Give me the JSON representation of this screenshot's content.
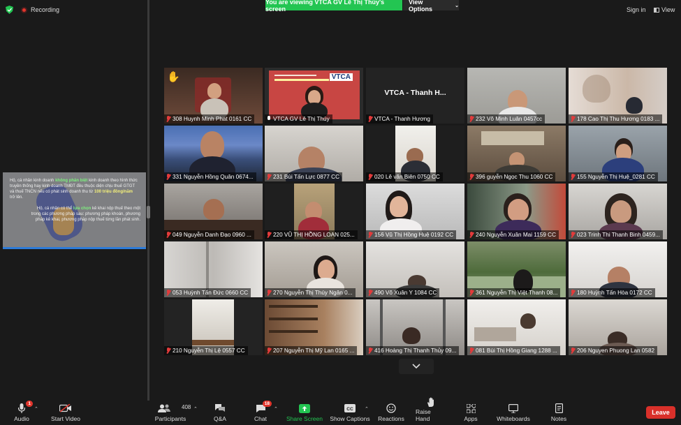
{
  "top": {
    "recording_label": "Recording",
    "viewing_banner": "You are viewing VTCA GV Lê Thị Thúy's screen",
    "view_options": "View Options",
    "sign_in": "Sign in",
    "view": "View"
  },
  "shared_screen": {
    "para1_a": "Hộ, cá nhân kinh doanh ",
    "para1_b": "không phân biệt",
    "para1_c": " kinh doanh theo hình thức truyền thống hay kinh doanh TMĐT đều thuộc diện chịu thuế GTGT và thuế TNCN nếu có phát sinh doanh thu từ ",
    "para1_d": "100 triệu đồng/năm",
    "para1_e": " trở lên.",
    "para2_a": "Hộ, cá nhân có thể ",
    "para2_b": "lựa chọn",
    "para2_c": " kê khai nộp thuế theo một trong các phương pháp sau: phương pháp khoán, phương pháp kê khai, phương pháp nộp thuế từng lần phát sinh."
  },
  "tiles": [
    {
      "label": "308 Huynh Minh Phat 0161 CC"
    },
    {
      "label": "VTCA GV Lê Thị Thúy"
    },
    {
      "label": "VTCA - Thanh Hương",
      "card": "VTCA - Thanh H..."
    },
    {
      "label": "232 Võ Minh Luân 0457cc"
    },
    {
      "label": "178 Cao Thị Thu Hương 0183 ..."
    },
    {
      "label": "331 Nguyễn Hồng Quân 0674..."
    },
    {
      "label": "231 Bùi Tấn Lực 0877 CC"
    },
    {
      "label": "020 Lê văn Biên 0750 CC"
    },
    {
      "label": "396 guyễn Ngọc Thu 1060 CC"
    },
    {
      "label": "155 Nguyễn Thị Huệ_0281 CC"
    },
    {
      "label": "049 Nguyễn Danh Đạo 0960 ..."
    },
    {
      "label": "220 VŨ THỊ HỒNG LOAN 025..."
    },
    {
      "label": "156 Vũ Thị Hồng Huệ 0192 CC"
    },
    {
      "label": "240 Nguyễn Xuân Mai 1159 CC"
    },
    {
      "label": "023 Trinh Thi Thanh Binh 0459..."
    },
    {
      "label": "053 Huỳnh Tấn Đức 0660 CC"
    },
    {
      "label": "270 Nguyễn Thị Thúy Ngân 0..."
    },
    {
      "label": "490 Võ Xuân Y 1084 CC"
    },
    {
      "label": "361 Nguyễn Thị Việt Thanh 08..."
    },
    {
      "label": "180 Huỳnh Tấn Hòa 0172 CC"
    },
    {
      "label": "210 Nguyễn Thị Lệ 0557 CC"
    },
    {
      "label": "207 Nguyễn Thị Mỹ Lan 0165 ..."
    },
    {
      "label": "416 Hoàng Thị Thanh Thủy 09..."
    },
    {
      "label": "081 Bùi Thị Hồng Giang 1288 ..."
    },
    {
      "label": "206 Nguyen Phuong Lan 0582"
    }
  ],
  "toolbar": {
    "audio": "Audio",
    "audio_badge": "1",
    "start_video": "Start Video",
    "participants": "Participants",
    "participants_count": "408",
    "qa": "Q&A",
    "chat": "Chat",
    "chat_badge": "18",
    "share_screen": "Share Screen",
    "show_captions": "Show Captions",
    "reactions": "Reactions",
    "raise_hand": "Raise Hand",
    "apps": "Apps",
    "whiteboards": "Whiteboards",
    "notes": "Notes",
    "leave": "Leave"
  },
  "colors": {
    "share_green": "#23c552",
    "leave_red": "#d9302a",
    "active_speaker": "#e3e33a"
  }
}
